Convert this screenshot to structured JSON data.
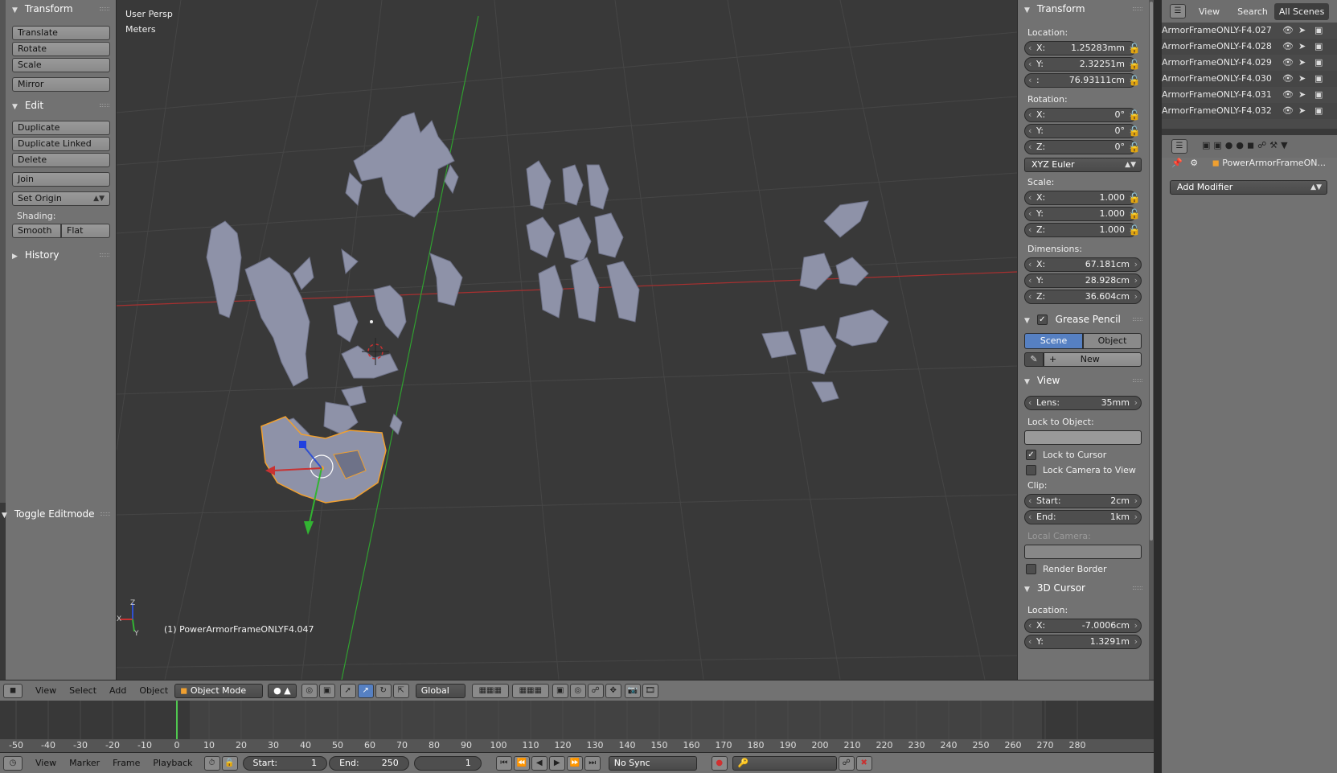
{
  "tool_shelf": {
    "transform": {
      "title": "Transform",
      "buttons": [
        "Translate",
        "Rotate",
        "Scale"
      ],
      "mirror": "Mirror"
    },
    "edit": {
      "title": "Edit",
      "buttons": [
        "Duplicate",
        "Duplicate Linked",
        "Delete"
      ],
      "join": "Join",
      "set_origin": "Set Origin",
      "shading_label": "Shading:",
      "smooth": "Smooth",
      "flat": "Flat"
    },
    "history": {
      "title": "History"
    }
  },
  "operator_panel": {
    "title": "Toggle Editmode"
  },
  "viewport": {
    "view_name": "User Persp",
    "units": "Meters",
    "active_object": "(1) PowerArmorFrameONLYF4.047",
    "axis_labels": {
      "x": "X",
      "y": "Y",
      "z": "Z"
    }
  },
  "properties": {
    "transform_title": "Transform",
    "location_label": "Location:",
    "location": [
      {
        "axis": "X:",
        "value": "1.25283mm"
      },
      {
        "axis": "Y:",
        "value": "2.32251m"
      },
      {
        "axis": ":",
        "value": "76.93111cm"
      }
    ],
    "rotation_label": "Rotation:",
    "rotation": [
      {
        "axis": "X:",
        "value": "0°"
      },
      {
        "axis": "Y:",
        "value": "0°"
      },
      {
        "axis": "Z:",
        "value": "0°"
      }
    ],
    "rotation_mode": "XYZ Euler",
    "scale_label": "Scale:",
    "scale": [
      {
        "axis": "X:",
        "value": "1.000"
      },
      {
        "axis": "Y:",
        "value": "1.000"
      },
      {
        "axis": "Z:",
        "value": "1.000"
      }
    ],
    "dimensions_label": "Dimensions:",
    "dimensions": [
      {
        "axis": "X:",
        "value": "67.181cm"
      },
      {
        "axis": "Y:",
        "value": "28.928cm"
      },
      {
        "axis": "Z:",
        "value": "36.604cm"
      }
    ],
    "grease_pencil_title": "Grease Pencil",
    "gp_scene": "Scene",
    "gp_object": "Object",
    "gp_new": "New",
    "view_title": "View",
    "lens_label": "Lens:",
    "lens_value": "35mm",
    "lock_to_object_label": "Lock to Object:",
    "lock_to_cursor": "Lock to Cursor",
    "lock_camera_to_view": "Lock Camera to View",
    "clip_label": "Clip:",
    "clip_start_label": "Start:",
    "clip_start": "2cm",
    "clip_end_label": "End:",
    "clip_end": "1km",
    "local_camera_label": "Local Camera:",
    "render_border": "Render Border",
    "cursor_title": "3D Cursor",
    "cursor_location_label": "Location:",
    "cursor_location": [
      {
        "axis": "X:",
        "value": "-7.0006cm"
      },
      {
        "axis": "Y:",
        "value": "1.3291m"
      }
    ]
  },
  "outliner": {
    "header": {
      "view": "View",
      "search": "Search",
      "scenes": "All Scenes"
    },
    "items": [
      "ArmorFrameONLY-F4.027",
      "ArmorFrameONLY-F4.028",
      "ArmorFrameONLY-F4.029",
      "ArmorFrameONLY-F4.030",
      "ArmorFrameONLY-F4.031",
      "ArmorFrameONLY-F4.032"
    ]
  },
  "property_editor": {
    "object_name": "PowerArmorFrameON...",
    "add_modifier": "Add Modifier"
  },
  "view3d_header": {
    "menus": [
      "View",
      "Select",
      "Add",
      "Object"
    ],
    "mode": "Object Mode",
    "orientation": "Global"
  },
  "timeline": {
    "current_frame": 0,
    "ruler_ticks": [
      "-50",
      "-40",
      "-30",
      "-20",
      "-10",
      "0",
      "10",
      "20",
      "30",
      "40",
      "50",
      "60",
      "70",
      "80",
      "90",
      "100",
      "110",
      "120",
      "130",
      "140",
      "150",
      "160",
      "170",
      "180",
      "190",
      "200",
      "210",
      "220",
      "230",
      "240",
      "250",
      "260",
      "270",
      "280"
    ],
    "menus": [
      "View",
      "Marker",
      "Frame",
      "Playback"
    ],
    "start_label": "Start:",
    "start_value": "1",
    "end_label": "End:",
    "end_value": "250",
    "frame_value": "1",
    "sync": "No Sync"
  },
  "colors": {
    "viewport_bg": "#393939",
    "panel_bg": "#727272",
    "x_axis": "#c83232",
    "y_axis": "#32b432",
    "selection": "#f0a030",
    "toggle_active": "#5680c2",
    "mesh": "#8e92a8"
  }
}
